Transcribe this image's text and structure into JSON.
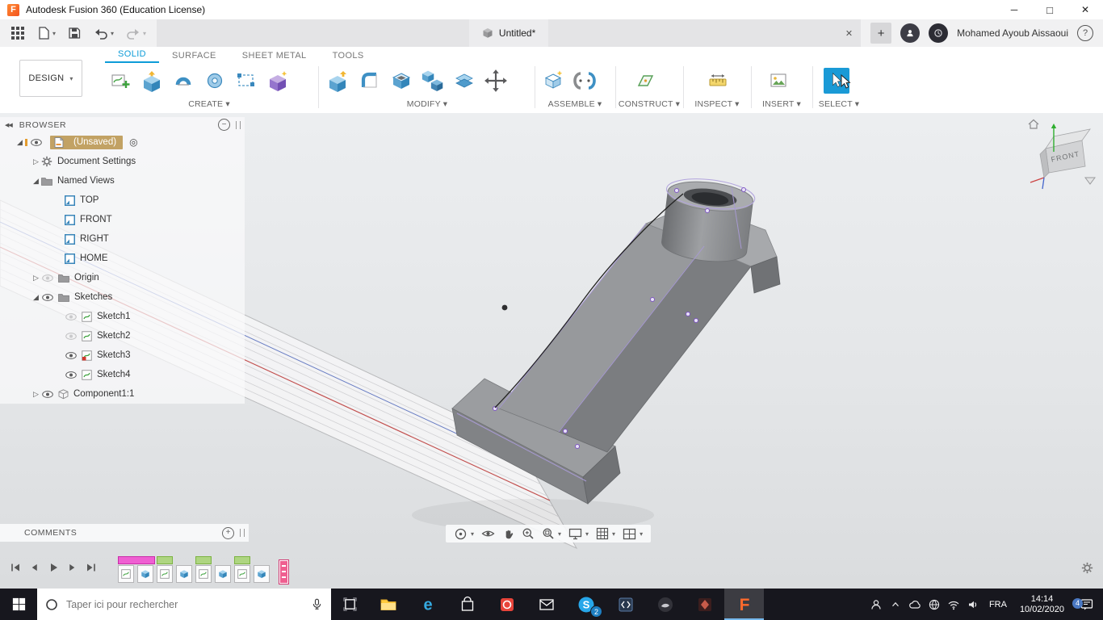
{
  "icons": {
    "fusion_f": "F",
    "caret": "▾",
    "minimize": "─",
    "maximize": "□",
    "close": "✕",
    "plus": "+",
    "minus": "−",
    "help": "?",
    "record": "◎",
    "collapse_double": "◀◀",
    "arrow_open": "◢",
    "arrow_closed": "▷",
    "edge_e": "e",
    "skype_s": "S"
  },
  "titlebar": {
    "title": "Autodesk Fusion 360 (Education License)"
  },
  "appbar": {
    "doc_tab": "Untitled*",
    "username": "Mohamed Ayoub Aissaoui"
  },
  "ribbon": {
    "design_label": "DESIGN",
    "tabs": [
      {
        "label": "SOLID"
      },
      {
        "label": "SURFACE"
      },
      {
        "label": "SHEET METAL"
      },
      {
        "label": "TOOLS"
      }
    ],
    "groups": [
      {
        "label": "CREATE"
      },
      {
        "label": "MODIFY"
      },
      {
        "label": "ASSEMBLE"
      },
      {
        "label": "CONSTRUCT"
      },
      {
        "label": "INSPECT"
      },
      {
        "label": "INSERT"
      },
      {
        "label": "SELECT"
      }
    ]
  },
  "browser": {
    "title": "BROWSER",
    "items": {
      "unsaved": "(Unsaved)",
      "document_settings": "Document Settings",
      "named_views": "Named Views",
      "view_top": "TOP",
      "view_front": "FRONT",
      "view_right": "RIGHT",
      "view_home": "HOME",
      "origin": "Origin",
      "sketches": "Sketches",
      "sketch1": "Sketch1",
      "sketch2": "Sketch2",
      "sketch3": "Sketch3",
      "sketch4": "Sketch4",
      "component1": "Component1:1"
    }
  },
  "viewcube": {
    "face": "FRONT"
  },
  "comments": {
    "title": "COMMENTS"
  },
  "taskbar": {
    "search_placeholder": "Taper ici pour rechercher",
    "language": "FRA",
    "time": "14:14",
    "date": "10/02/2020",
    "skype_badge": "2",
    "notification_badge": "4"
  }
}
